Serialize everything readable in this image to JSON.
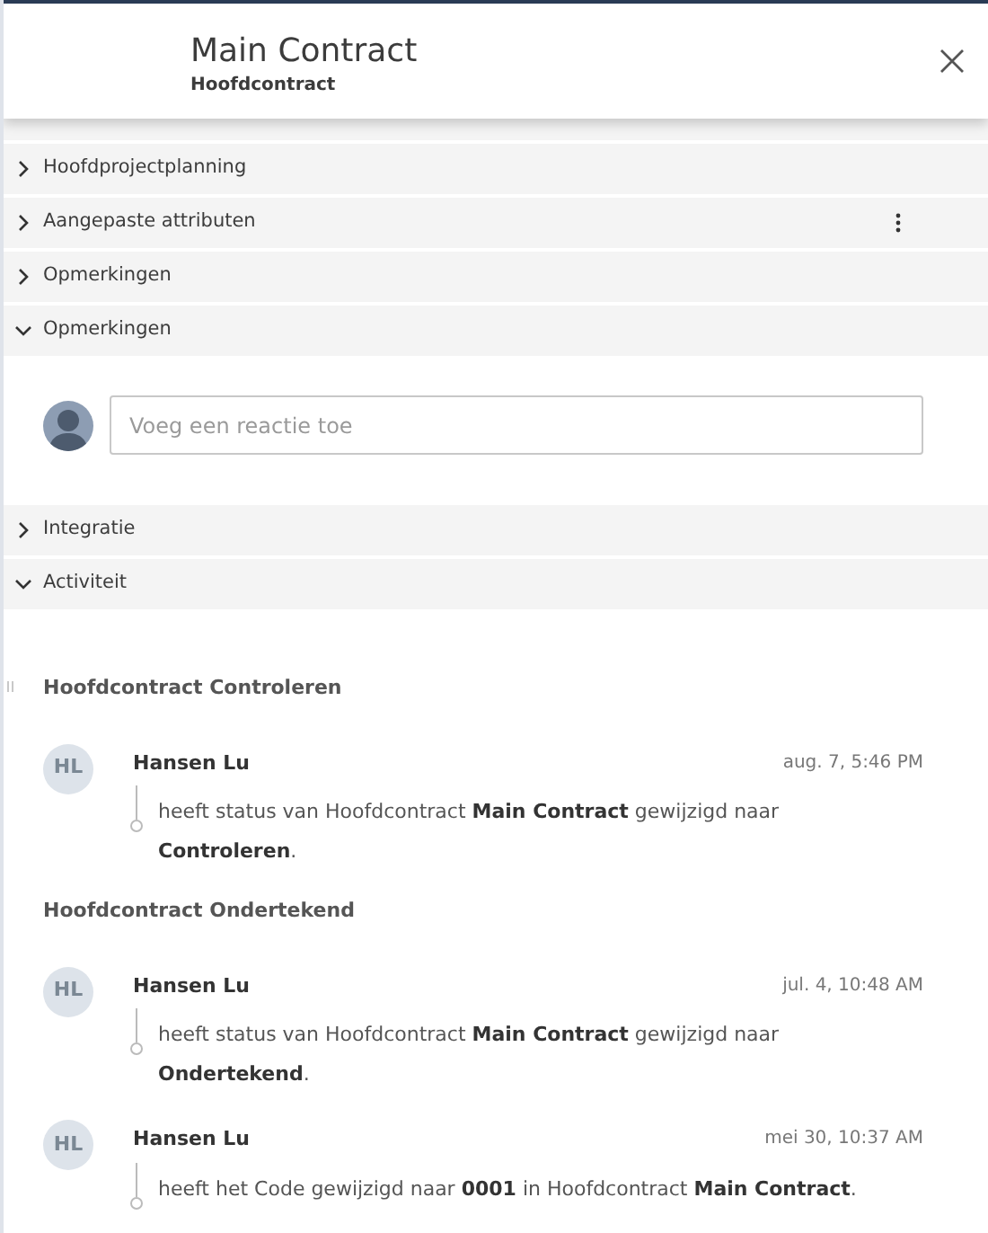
{
  "header": {
    "title": "Main Contract",
    "subtitle": "Hoofdcontract"
  },
  "sections": [
    {
      "label": "Hoofdprojectplanning",
      "expanded": false
    },
    {
      "label": "Aangepaste attributen",
      "expanded": false,
      "has_menu": true
    },
    {
      "label": "Opmerkingen",
      "expanded": false
    },
    {
      "label": "Opmerkingen",
      "expanded": true,
      "kind": "comments",
      "comment": {
        "placeholder": "Voeg een reactie toe"
      }
    },
    {
      "label": "Integratie",
      "expanded": false
    },
    {
      "label": "Activiteit",
      "expanded": true,
      "kind": "activity",
      "groups": [
        {
          "title": "Hoofdcontract Controleren",
          "entries": [
            {
              "initials": "HL",
              "author": "Hansen Lu",
              "time": "aug. 7, 5:46 PM",
              "text": "heeft status van Hoofdcontract **Main Contract** gewijzigd naar **Controleren**."
            }
          ]
        },
        {
          "title": "Hoofdcontract Ondertekend",
          "entries": [
            {
              "initials": "HL",
              "author": "Hansen Lu",
              "time": "jul. 4, 10:48 AM",
              "text": "heeft status van Hoofdcontract **Main Contract** gewijzigd naar **Ondertekend**."
            },
            {
              "initials": "HL",
              "author": "Hansen Lu",
              "time": "mei 30, 10:37 AM",
              "text": "heeft het Code gewijzigd naar **0001** in Hoofdcontract **Main Contract**."
            }
          ]
        }
      ]
    }
  ]
}
